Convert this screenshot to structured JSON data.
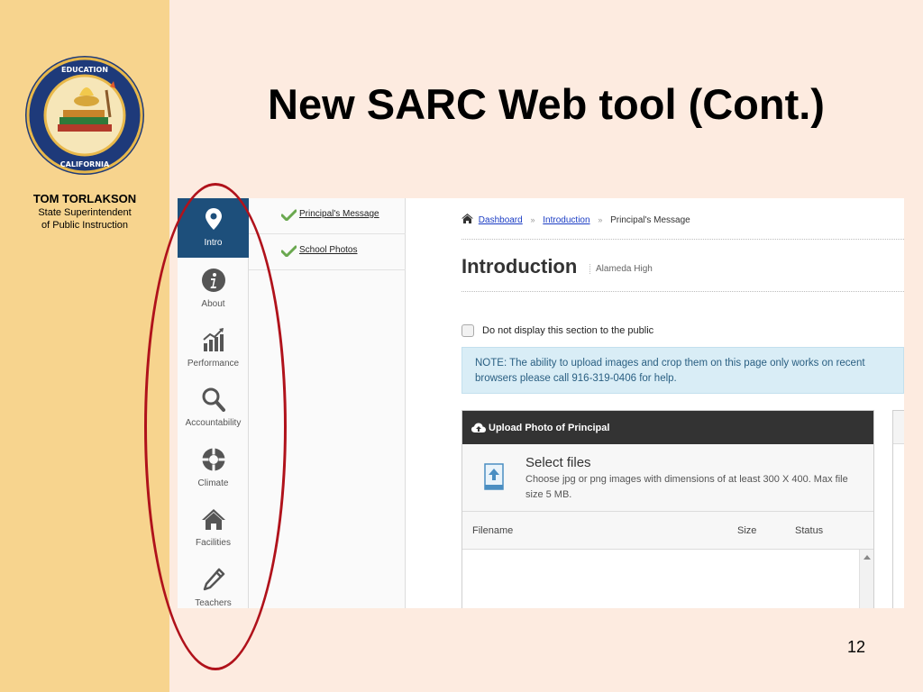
{
  "slide": {
    "title": "New SARC Web tool (Cont.)",
    "page_number": "12",
    "presenter_name": "TOM TORLAKSON",
    "presenter_title_line1": "State Superintendent",
    "presenter_title_line2": "of Public Instruction",
    "seal_text": "DEPARTMENT OF EDUCATION · STATE OF CALIFORNIA",
    "seal_icon": "department-of-education-seal",
    "colors": {
      "left_strip": "#f7d48e",
      "background": "#fdebe0",
      "highlight_oval": "#b0121b"
    }
  },
  "app": {
    "nav": [
      {
        "label": "Intro",
        "icon": "map-pin-icon",
        "active": true
      },
      {
        "label": "About",
        "icon": "info-icon",
        "active": false
      },
      {
        "label": "Performance",
        "icon": "bar-chart-trend-icon",
        "active": false
      },
      {
        "label": "Accountability",
        "icon": "magnifier-icon",
        "active": false
      },
      {
        "label": "Climate",
        "icon": "life-ring-icon",
        "active": false
      },
      {
        "label": "Facilities",
        "icon": "home-icon",
        "active": false
      },
      {
        "label": "Teachers",
        "icon": "pencil-icon",
        "active": false
      }
    ],
    "sections": [
      {
        "label": "Principal's Message",
        "icon": "checkmark-icon",
        "complete": true
      },
      {
        "label": "School Photos",
        "icon": "checkmark-icon",
        "complete": true
      }
    ],
    "breadcrumb": {
      "home_icon": "home-icon",
      "items": [
        "Dashboard",
        "Introduction"
      ],
      "current": "Principal's Message",
      "separator": "»"
    },
    "page_heading": "Introduction",
    "school_name": "Alameda High",
    "hide_section": {
      "label": "Do not display this section to the public",
      "checked": false
    },
    "note": "NOTE: The ability to upload images and crop them on this page only works on recent browsers please call 916-319-0406 for help.",
    "upload": {
      "title": "Upload Photo of Principal",
      "header_icon": "cloud-upload-icon",
      "select_title": "Select files",
      "select_description": "Choose jpg or png images with dimensions of at least 300 X 400. Max file size 5 MB.",
      "file_icon": "upload-file-icon",
      "columns": [
        "Filename",
        "Size",
        "Status"
      ]
    },
    "colors": {
      "nav_active": "#1d4f7b",
      "upload_header": "#333333",
      "note_background": "#d9edf6",
      "note_text": "#2a5f82",
      "link": "#1a3cc4"
    }
  }
}
